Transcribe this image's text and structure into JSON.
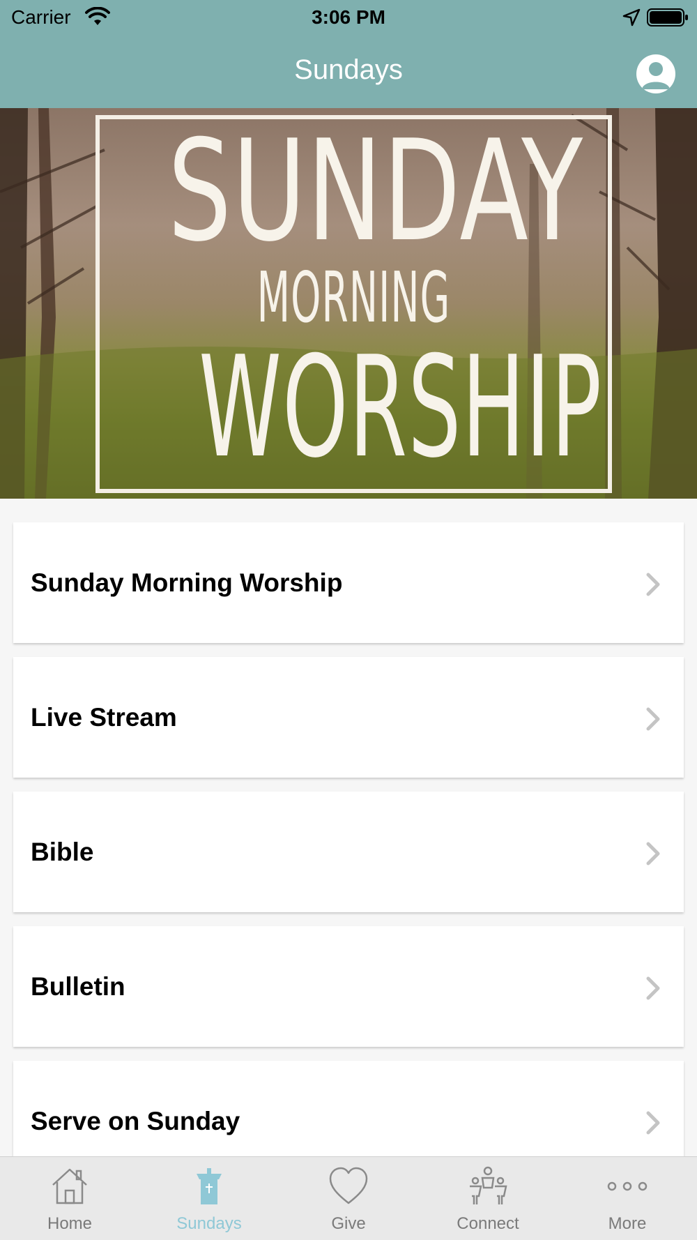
{
  "status_bar": {
    "carrier": "Carrier",
    "time": "3:06 PM"
  },
  "nav": {
    "title": "Sundays"
  },
  "hero": {
    "line1": "SUNDAY",
    "line2": "MORNING",
    "line3": "WORSHIP"
  },
  "list": {
    "items": [
      {
        "label": "Sunday Morning Worship"
      },
      {
        "label": "Live Stream"
      },
      {
        "label": "Bible"
      },
      {
        "label": "Bulletin"
      },
      {
        "label": "Serve on Sunday"
      }
    ]
  },
  "tab_bar": {
    "active_color": "#8fc8d6",
    "inactive_color": "#7a7a7a",
    "tabs": [
      {
        "label": "Home",
        "icon": "house-icon"
      },
      {
        "label": "Sundays",
        "icon": "pulpit-icon"
      },
      {
        "label": "Give",
        "icon": "heart-icon"
      },
      {
        "label": "Connect",
        "icon": "people-icon"
      },
      {
        "label": "More",
        "icon": "ellipsis-icon"
      }
    ]
  },
  "colors": {
    "header_teal": "#7fb0af"
  }
}
